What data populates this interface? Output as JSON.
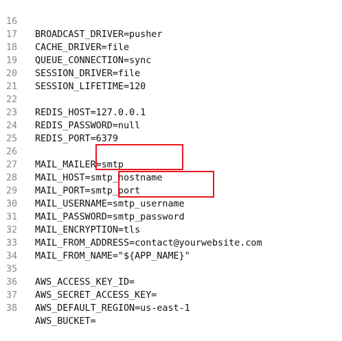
{
  "editor": {
    "lines": [
      {
        "num": "16",
        "text": "BROADCAST_DRIVER=pusher"
      },
      {
        "num": "17",
        "text": "CACHE_DRIVER=file"
      },
      {
        "num": "18",
        "text": "QUEUE_CONNECTION=sync"
      },
      {
        "num": "19",
        "text": "SESSION_DRIVER=file"
      },
      {
        "num": "20",
        "text": "SESSION_LIFETIME=120"
      },
      {
        "num": "21",
        "text": ""
      },
      {
        "num": "22",
        "text": "REDIS_HOST=127.0.0.1"
      },
      {
        "num": "23",
        "text": "REDIS_PASSWORD=null"
      },
      {
        "num": "24",
        "text": "REDIS_PORT=6379"
      },
      {
        "num": "25",
        "text": ""
      },
      {
        "num": "26",
        "text": "MAIL_MAILER=smtp"
      },
      {
        "num": "27",
        "text": "MAIL_HOST=smtp_hostname"
      },
      {
        "num": "28",
        "text": "MAIL_PORT=smtp_port"
      },
      {
        "num": "29",
        "text": "MAIL_USERNAME=smtp_username"
      },
      {
        "num": "30",
        "text": "MAIL_PASSWORD=smtp_password"
      },
      {
        "num": "31",
        "text": "MAIL_ENCRYPTION=tls"
      },
      {
        "num": "32",
        "text": "MAIL_FROM_ADDRESS=contact@yourwebsite.com"
      },
      {
        "num": "33",
        "text": "MAIL_FROM_NAME=\"${APP_NAME}\""
      },
      {
        "num": "34",
        "text": ""
      },
      {
        "num": "35",
        "text": "AWS_ACCESS_KEY_ID="
      },
      {
        "num": "36",
        "text": "AWS_SECRET_ACCESS_KEY="
      },
      {
        "num": "37",
        "text": "AWS_DEFAULT_REGION=us-east-1"
      },
      {
        "num": "38",
        "text": "AWS_BUCKET="
      }
    ]
  },
  "colors": {
    "highlight": "#e8141b",
    "line_number": "#888888",
    "code_text": "#111111"
  }
}
